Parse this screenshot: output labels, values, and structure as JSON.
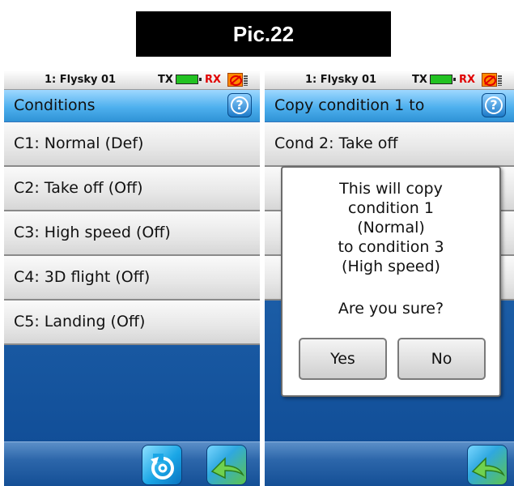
{
  "pic_label": "Pic.22",
  "left_screen": {
    "status": {
      "model": "1: Flysky 01",
      "tx": "TX",
      "rx": "RX"
    },
    "title": "Conditions",
    "items": [
      {
        "label": "C1: Normal (Def)"
      },
      {
        "label": "C2: Take off (Off)"
      },
      {
        "label": "C3: High speed (Off)"
      },
      {
        "label": "C4: 3D flight (Off)"
      },
      {
        "label": "C5: Landing (Off)"
      }
    ]
  },
  "right_screen": {
    "status": {
      "model": "1: Flysky 01",
      "tx": "TX",
      "rx": "RX"
    },
    "title": "Copy condition 1 to",
    "items": [
      {
        "label": "Cond 2: Take off"
      }
    ],
    "dialog": {
      "message": "This will copy\ncondition 1\n(Normal)\nto condition 3\n(High speed)",
      "question": "Are you sure?",
      "yes_label": "Yes",
      "no_label": "No"
    }
  },
  "colors": {
    "title_bar": "#4eb0ee",
    "background": "#1d5fa8",
    "rx_text": "#e00000",
    "battery": "#22c222"
  }
}
